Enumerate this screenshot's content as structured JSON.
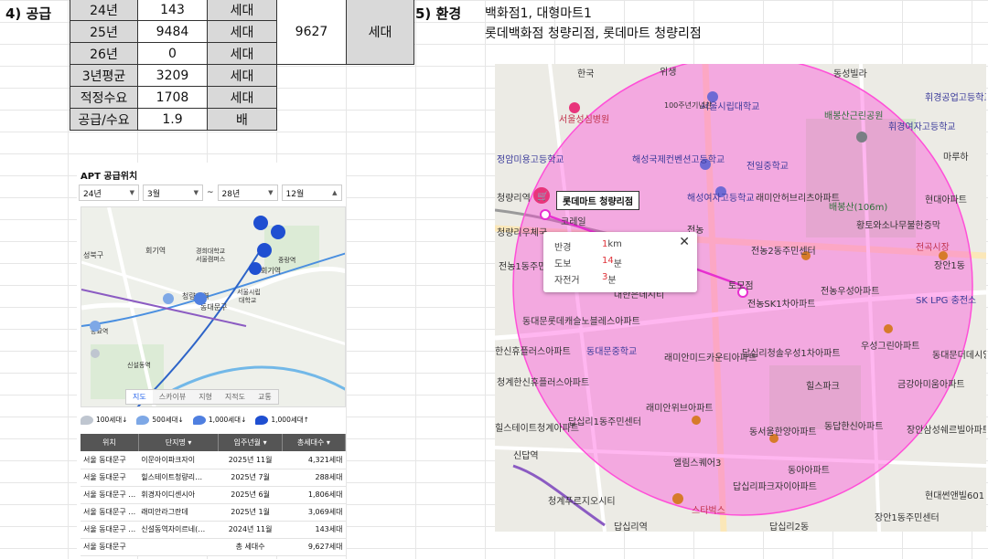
{
  "sections": {
    "supply_title": "4) 공급",
    "env_title": "5) 환경"
  },
  "supply_table": {
    "rows": [
      {
        "label": "24년",
        "value": "143",
        "unit": "세대"
      },
      {
        "label": "25년",
        "value": "9484",
        "unit": "세대"
      },
      {
        "label": "26년",
        "value": "0",
        "unit": "세대"
      },
      {
        "label": "3년평균",
        "value": "3209",
        "unit": "세대"
      },
      {
        "label": "적정수요",
        "value": "1708",
        "unit": "세대"
      },
      {
        "label": "공급/수요",
        "value": "1.9",
        "unit": "배"
      }
    ],
    "total_value": "9627",
    "total_unit": "세대"
  },
  "environment": {
    "line1": "백화점1, 대형마트1",
    "line2": "롯데백화점 청량리점, 롯데마트 청량리점"
  },
  "apt_panel": {
    "title": "APT 공급위치",
    "filters": {
      "from_year": "24년",
      "from_month": "3월",
      "separator": "~",
      "to_year": "28년",
      "to_month": "12월"
    },
    "map_tabs": [
      "지도",
      "스카이뷰",
      "지형",
      "지적도",
      "교통"
    ],
    "map_labels": {
      "cheongnyangni": "청량리역",
      "hoegi": "회기역",
      "dongdaemungu": "동대문구",
      "seongbukgu": "성북구",
      "kyunghee": "경희대학교 서울캠퍼스",
      "seoulsiripdae": "서울시립대학교"
    },
    "legend": [
      "100세대↓",
      "500세대↓",
      "1,000세대↓",
      "1,000세대↑"
    ],
    "legend_colors": [
      "#bfc6d0",
      "#7ea8e6",
      "#4f7fe0",
      "#1f4fd1"
    ],
    "list_headers": [
      "위치",
      "단지명 ▾",
      "입주년월 ▾",
      "총세대수 ▾"
    ],
    "list_rows": [
      {
        "loc": "서울 동대문구",
        "name": "이문아이파크자이",
        "date": "2025년 11월",
        "units": "4,321세대"
      },
      {
        "loc": "서울 동대문구",
        "name": "힐스테이트청량리…",
        "date": "2025년 7월",
        "units": "288세대"
      },
      {
        "loc": "서울 동대문구 …",
        "name": "휘경자이디센시아",
        "date": "2025년 6월",
        "units": "1,806세대"
      },
      {
        "loc": "서울 동대문구 …",
        "name": "래미안라그란데",
        "date": "2025년 1월",
        "units": "3,069세대"
      },
      {
        "loc": "서울 동대문구 …",
        "name": "신설동역자이르네(…",
        "date": "2024년 11월",
        "units": "143세대"
      }
    ],
    "total_row": {
      "loc": "서울 동대문구",
      "label": "총 세대수",
      "units": "9,627세대"
    }
  },
  "big_map": {
    "store_label": "롯데마트 청량리점",
    "popup": {
      "radius_label": "반경",
      "radius_value": "1",
      "radius_unit": " km",
      "walk_label": "도보",
      "walk_value": "14",
      "walk_unit": "분",
      "bike_label": "자전거",
      "bike_value": "3",
      "bike_unit": "분",
      "close": "✕"
    },
    "labels": {
      "l1": "동성빌라",
      "l2": "서울시립대학교",
      "l3": "100주년기념관",
      "l4": "배봉산근린공원",
      "l5": "휘경여자고등학교",
      "l6": "휘경공업고등학교",
      "l7": "서울성심병원",
      "l8": "해성국제컨벤션고등학교",
      "l9": "전일중학교",
      "l10": "정암미용고등학교",
      "l11": "해성여자고등학교",
      "l12": "래미안허브리츠아파트",
      "l13": "배봉산(106m)",
      "l14": "현대아파트",
      "l15": "청량리역",
      "l16": "롯데마트",
      "l17": "전농",
      "l18": "황토와소나무불한증막",
      "l19": "전농2동주민센터",
      "l20": "전곡시장",
      "l21": "전농1동주민센터",
      "l22": "전농SK1차아파트",
      "l23": "전농우성아파트",
      "l24": "SK LPG 충전소",
      "l25": "동대문롯데캐슬노블레스아파트",
      "l26": "동대문중학교",
      "l27": "한신휴플러스아파트",
      "l28": "래미안미드카운티아파트",
      "l29": "답십리청솔우성1차아파트",
      "l30": "우성그린아파트",
      "l31": "청계한신휴플러스아파트",
      "l32": "힐스파크",
      "l33": "금강아미움아파트",
      "l34": "래미안위브아파트",
      "l35": "답십리1동주민센터",
      "l36": "힐스테이트청계아파트",
      "l37": "동서울한양아파트",
      "l38": "동답한신아파트",
      "l39": "장안삼성쉐르빌아파트",
      "l40": "신답역",
      "l41": "엘림스퀘어3",
      "l42": "동아아파트",
      "l43": "청계푸르지오시티",
      "l44": "답십리파크자이아파트",
      "l45": "스타벅스",
      "l46": "현대썬앤빌601",
      "l47": "답십리역",
      "l48": "답십리2동",
      "l49": "장안1동주민센터",
      "l50": "마루하",
      "l51": "장안1동",
      "l52": "동대문더데시앙아",
      "l53": "코레일",
      "l54": "토모점",
      "l55": "위생",
      "l56": "대한은데시티",
      "l57": "청량리우체국",
      "l58": "한국"
    }
  }
}
